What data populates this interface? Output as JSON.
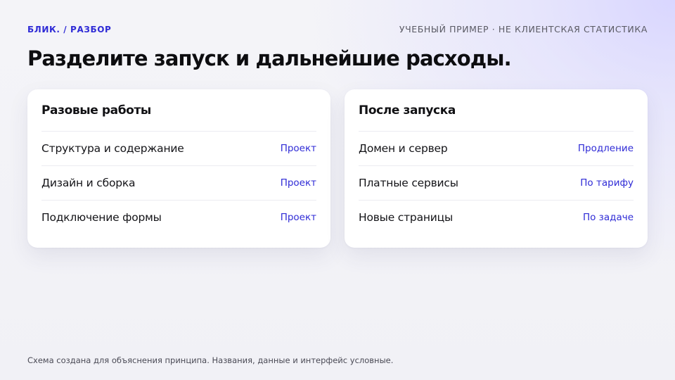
{
  "header": {
    "brand": "БЛИК. / РАЗБОР",
    "note": "УЧЕБНЫЙ ПРИМЕР · НЕ КЛИЕНТСКАЯ СТАТИСТИКА",
    "title": "Разделите запуск и дальнейшие расходы."
  },
  "cards": [
    {
      "title": "Разовые работы",
      "rows": [
        {
          "label": "Структура и содержание",
          "tag": "Проект"
        },
        {
          "label": "Дизайн и сборка",
          "tag": "Проект"
        },
        {
          "label": "Подключение формы",
          "tag": "Проект"
        }
      ]
    },
    {
      "title": "После запуска",
      "rows": [
        {
          "label": "Домен и сервер",
          "tag": "Продление"
        },
        {
          "label": "Платные сервисы",
          "tag": "По тарифу"
        },
        {
          "label": "Новые страницы",
          "tag": "По задаче"
        }
      ]
    }
  ],
  "footer": {
    "text": "Схема создана для объяснения принципа. Названия, данные и интерфейс условные."
  },
  "colors": {
    "accent": "#2f2bd6",
    "text": "#111114",
    "muted": "#5a5a64",
    "card_bg": "#ffffff"
  }
}
